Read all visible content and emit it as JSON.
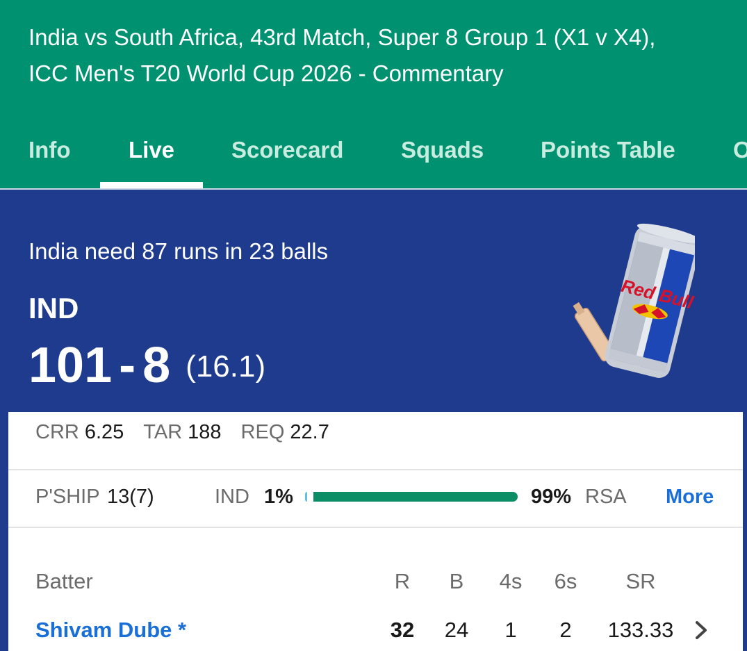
{
  "header": {
    "title_line1": "India vs South Africa, 43rd Match, Super 8 Group 1 (X1 v X4),",
    "title_line2": "ICC Men's T20 World Cup 2026 - Commentary",
    "tabs": [
      {
        "label": "Info",
        "active": false
      },
      {
        "label": "Live",
        "active": true
      },
      {
        "label": "Scorecard",
        "active": false
      },
      {
        "label": "Squads",
        "active": false
      },
      {
        "label": "Points Table",
        "active": false
      },
      {
        "label": "O",
        "active": false
      }
    ],
    "colors": {
      "header_bg": "#009270",
      "score_bg": "#1e3b8d",
      "link": "#1a6fd6"
    }
  },
  "score": {
    "status": "India need 87 runs in 23 balls",
    "team": "IND",
    "runs": "101",
    "separator": "-",
    "wickets": "8",
    "overs": "(16.1)"
  },
  "ad": {
    "brand": "Red Bull",
    "icon": "red-bull-can-icon"
  },
  "rates": {
    "crr_label": "CRR",
    "crr_value": "6.25",
    "tar_label": "TAR",
    "tar_value": "188",
    "req_label": "REQ",
    "req_value": "22.7"
  },
  "partnership": {
    "label": "P'SHIP",
    "value": "13(7)"
  },
  "win_probability": {
    "team_a": "IND",
    "team_a_pct": "1%",
    "team_a_fraction": 0.01,
    "team_b": "RSA",
    "team_b_pct": "99%",
    "team_b_fraction": 0.99,
    "more_label": "More"
  },
  "batters": {
    "headers": {
      "name": "Batter",
      "r": "R",
      "b": "B",
      "fours": "4s",
      "sixes": "6s",
      "sr": "SR"
    },
    "rows": [
      {
        "name": "Shivam Dube *",
        "r": "32",
        "b": "24",
        "fours": "1",
        "sixes": "2",
        "sr": "133.33"
      }
    ]
  }
}
